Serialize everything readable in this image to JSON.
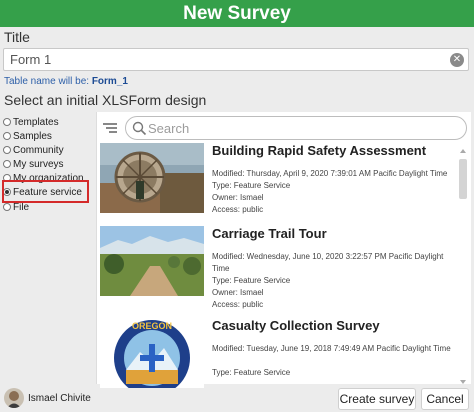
{
  "window": {
    "title": "New Survey"
  },
  "form": {
    "title_label": "Title",
    "title_value": "Form 1",
    "table_name_prefix": "Table name will be:",
    "table_name": "Form_1",
    "select_label": "Select an initial XLSForm design"
  },
  "sources": [
    {
      "label": "Templates",
      "selected": false
    },
    {
      "label": "Samples",
      "selected": false
    },
    {
      "label": "Community",
      "selected": false
    },
    {
      "label": "My surveys",
      "selected": false
    },
    {
      "label": "My organization",
      "selected": false
    },
    {
      "label": "Feature service",
      "selected": true
    },
    {
      "label": "File",
      "selected": false
    }
  ],
  "search": {
    "placeholder": "Search"
  },
  "items": [
    {
      "title": "Building Rapid Safety Assessment",
      "modified": "Modified: Thursday, April 9, 2020 7:39:01 AM Pacific Daylight Time",
      "type": "Type: Feature Service",
      "owner": "Owner: Ismael",
      "access": "Access: public"
    },
    {
      "title": "Carriage Trail Tour",
      "modified": "Modified: Wednesday, June 10, 2020 3:22:57 PM Pacific Daylight Time",
      "type": "Type: Feature Service",
      "owner": "Owner: Ismael",
      "access": "Access: public"
    },
    {
      "title": "Casualty Collection Survey",
      "modified": "Modified: Tuesday, June 19, 2018 7:49:49 AM Pacific Daylight Time",
      "type": "Type: Feature Service",
      "thumb_text": "OREGON"
    }
  ],
  "footer": {
    "user": "Ismael Chivite",
    "create_label": "Create survey",
    "cancel_label": "Cancel"
  },
  "colors": {
    "header": "#35a04a",
    "highlight": "#d42a2a",
    "link": "#2d5fa8"
  }
}
